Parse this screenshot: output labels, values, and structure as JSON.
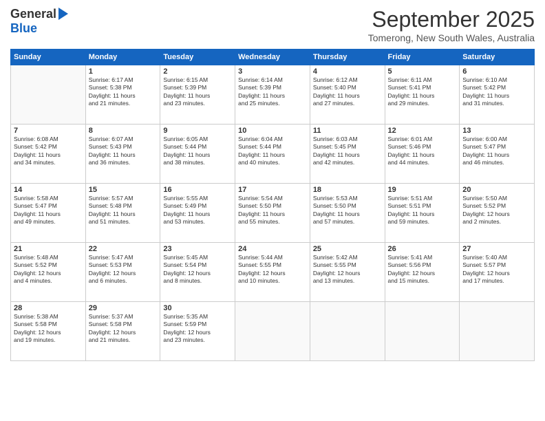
{
  "logo": {
    "general": "General",
    "blue": "Blue"
  },
  "header": {
    "month": "September 2025",
    "location": "Tomerong, New South Wales, Australia"
  },
  "weekdays": [
    "Sunday",
    "Monday",
    "Tuesday",
    "Wednesday",
    "Thursday",
    "Friday",
    "Saturday"
  ],
  "weeks": [
    [
      {
        "day": "",
        "sunrise": "",
        "sunset": "",
        "daylight": ""
      },
      {
        "day": "1",
        "sunrise": "Sunrise: 6:17 AM",
        "sunset": "Sunset: 5:38 PM",
        "daylight": "Daylight: 11 hours and 21 minutes."
      },
      {
        "day": "2",
        "sunrise": "Sunrise: 6:15 AM",
        "sunset": "Sunset: 5:39 PM",
        "daylight": "Daylight: 11 hours and 23 minutes."
      },
      {
        "day": "3",
        "sunrise": "Sunrise: 6:14 AM",
        "sunset": "Sunset: 5:39 PM",
        "daylight": "Daylight: 11 hours and 25 minutes."
      },
      {
        "day": "4",
        "sunrise": "Sunrise: 6:12 AM",
        "sunset": "Sunset: 5:40 PM",
        "daylight": "Daylight: 11 hours and 27 minutes."
      },
      {
        "day": "5",
        "sunrise": "Sunrise: 6:11 AM",
        "sunset": "Sunset: 5:41 PM",
        "daylight": "Daylight: 11 hours and 29 minutes."
      },
      {
        "day": "6",
        "sunrise": "Sunrise: 6:10 AM",
        "sunset": "Sunset: 5:42 PM",
        "daylight": "Daylight: 11 hours and 31 minutes."
      }
    ],
    [
      {
        "day": "7",
        "sunrise": "Sunrise: 6:08 AM",
        "sunset": "Sunset: 5:42 PM",
        "daylight": "Daylight: 11 hours and 34 minutes."
      },
      {
        "day": "8",
        "sunrise": "Sunrise: 6:07 AM",
        "sunset": "Sunset: 5:43 PM",
        "daylight": "Daylight: 11 hours and 36 minutes."
      },
      {
        "day": "9",
        "sunrise": "Sunrise: 6:05 AM",
        "sunset": "Sunset: 5:44 PM",
        "daylight": "Daylight: 11 hours and 38 minutes."
      },
      {
        "day": "10",
        "sunrise": "Sunrise: 6:04 AM",
        "sunset": "Sunset: 5:44 PM",
        "daylight": "Daylight: 11 hours and 40 minutes."
      },
      {
        "day": "11",
        "sunrise": "Sunrise: 6:03 AM",
        "sunset": "Sunset: 5:45 PM",
        "daylight": "Daylight: 11 hours and 42 minutes."
      },
      {
        "day": "12",
        "sunrise": "Sunrise: 6:01 AM",
        "sunset": "Sunset: 5:46 PM",
        "daylight": "Daylight: 11 hours and 44 minutes."
      },
      {
        "day": "13",
        "sunrise": "Sunrise: 6:00 AM",
        "sunset": "Sunset: 5:47 PM",
        "daylight": "Daylight: 11 hours and 46 minutes."
      }
    ],
    [
      {
        "day": "14",
        "sunrise": "Sunrise: 5:58 AM",
        "sunset": "Sunset: 5:47 PM",
        "daylight": "Daylight: 11 hours and 49 minutes."
      },
      {
        "day": "15",
        "sunrise": "Sunrise: 5:57 AM",
        "sunset": "Sunset: 5:48 PM",
        "daylight": "Daylight: 11 hours and 51 minutes."
      },
      {
        "day": "16",
        "sunrise": "Sunrise: 5:55 AM",
        "sunset": "Sunset: 5:49 PM",
        "daylight": "Daylight: 11 hours and 53 minutes."
      },
      {
        "day": "17",
        "sunrise": "Sunrise: 5:54 AM",
        "sunset": "Sunset: 5:50 PM",
        "daylight": "Daylight: 11 hours and 55 minutes."
      },
      {
        "day": "18",
        "sunrise": "Sunrise: 5:53 AM",
        "sunset": "Sunset: 5:50 PM",
        "daylight": "Daylight: 11 hours and 57 minutes."
      },
      {
        "day": "19",
        "sunrise": "Sunrise: 5:51 AM",
        "sunset": "Sunset: 5:51 PM",
        "daylight": "Daylight: 11 hours and 59 minutes."
      },
      {
        "day": "20",
        "sunrise": "Sunrise: 5:50 AM",
        "sunset": "Sunset: 5:52 PM",
        "daylight": "Daylight: 12 hours and 2 minutes."
      }
    ],
    [
      {
        "day": "21",
        "sunrise": "Sunrise: 5:48 AM",
        "sunset": "Sunset: 5:52 PM",
        "daylight": "Daylight: 12 hours and 4 minutes."
      },
      {
        "day": "22",
        "sunrise": "Sunrise: 5:47 AM",
        "sunset": "Sunset: 5:53 PM",
        "daylight": "Daylight: 12 hours and 6 minutes."
      },
      {
        "day": "23",
        "sunrise": "Sunrise: 5:45 AM",
        "sunset": "Sunset: 5:54 PM",
        "daylight": "Daylight: 12 hours and 8 minutes."
      },
      {
        "day": "24",
        "sunrise": "Sunrise: 5:44 AM",
        "sunset": "Sunset: 5:55 PM",
        "daylight": "Daylight: 12 hours and 10 minutes."
      },
      {
        "day": "25",
        "sunrise": "Sunrise: 5:42 AM",
        "sunset": "Sunset: 5:55 PM",
        "daylight": "Daylight: 12 hours and 13 minutes."
      },
      {
        "day": "26",
        "sunrise": "Sunrise: 5:41 AM",
        "sunset": "Sunset: 5:56 PM",
        "daylight": "Daylight: 12 hours and 15 minutes."
      },
      {
        "day": "27",
        "sunrise": "Sunrise: 5:40 AM",
        "sunset": "Sunset: 5:57 PM",
        "daylight": "Daylight: 12 hours and 17 minutes."
      }
    ],
    [
      {
        "day": "28",
        "sunrise": "Sunrise: 5:38 AM",
        "sunset": "Sunset: 5:58 PM",
        "daylight": "Daylight: 12 hours and 19 minutes."
      },
      {
        "day": "29",
        "sunrise": "Sunrise: 5:37 AM",
        "sunset": "Sunset: 5:58 PM",
        "daylight": "Daylight: 12 hours and 21 minutes."
      },
      {
        "day": "30",
        "sunrise": "Sunrise: 5:35 AM",
        "sunset": "Sunset: 5:59 PM",
        "daylight": "Daylight: 12 hours and 23 minutes."
      },
      {
        "day": "",
        "sunrise": "",
        "sunset": "",
        "daylight": ""
      },
      {
        "day": "",
        "sunrise": "",
        "sunset": "",
        "daylight": ""
      },
      {
        "day": "",
        "sunrise": "",
        "sunset": "",
        "daylight": ""
      },
      {
        "day": "",
        "sunrise": "",
        "sunset": "",
        "daylight": ""
      }
    ]
  ]
}
